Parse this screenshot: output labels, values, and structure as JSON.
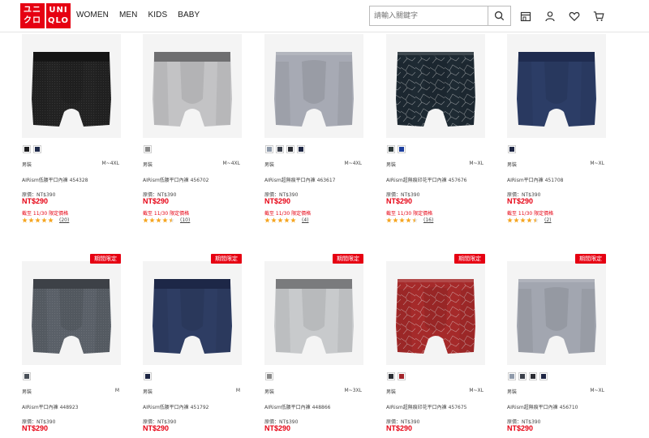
{
  "header": {
    "logo": {
      "left": "ユニ\nクロ",
      "right": "UNI\nQLO"
    },
    "nav": [
      "WOMEN",
      "MEN",
      "KIDS",
      "BABY"
    ],
    "search_placeholder": "請輸入關鍵字"
  },
  "products": [
    {
      "badge": "",
      "swatches": [
        "#1d1d1f",
        "#1f2a4a"
      ],
      "gender": "男裝",
      "size": "M~4XL",
      "name": "AIRism低腰平口內褲 454328",
      "orig": "原價：NT$390",
      "price": "NT$290",
      "promo": "截至 11/30 限定價格",
      "rating": 5,
      "count": "(20)",
      "color": "#222",
      "band": "#151515",
      "pattern": "mesh"
    },
    {
      "badge": "",
      "swatches": [
        "#8a8a8a"
      ],
      "gender": "男裝",
      "size": "M~4XL",
      "name": "AIRism低腰平口內褲 456702",
      "orig": "原價：NT$390",
      "price": "NT$290",
      "promo": "截至 11/30 限定價格",
      "rating": 4.5,
      "count": "(10)",
      "color": "#c3c3c5",
      "band": "#6e6e70",
      "pattern": "plain"
    },
    {
      "badge": "",
      "swatches": [
        "#8f9aaa",
        "#3a3f4a",
        "#2b2d33",
        "#1e2644"
      ],
      "gender": "男裝",
      "size": "M~4XL",
      "name": "AIRism超無痕平口內褲 463617",
      "orig": "原價：NT$390",
      "price": "NT$290",
      "promo": "截至 11/30 限定價格",
      "rating": 5,
      "count": "(4)",
      "color": "#a7aab4",
      "band": "#a7aab4",
      "pattern": "plain"
    },
    {
      "badge": "",
      "swatches": [
        "#2f3a3a",
        "#1d3f9e"
      ],
      "gender": "男裝",
      "size": "M~XL",
      "name": "AIRism超無痕印花平口內褲 457676",
      "orig": "原價：NT$390",
      "price": "NT$290",
      "promo": "截至 11/30 限定價格",
      "rating": 4.5,
      "count": "(16)",
      "color": "#1e2a33",
      "band": "#1e2a33",
      "pattern": "print"
    },
    {
      "badge": "",
      "swatches": [
        "#1e2644"
      ],
      "gender": "男裝",
      "size": "M~XL",
      "name": "AIRism平口內褲 451708",
      "orig": "原價：NT$390",
      "price": "NT$290",
      "promo": "截至 11/30 限定價格",
      "rating": 4.5,
      "count": "(2)",
      "color": "#2c3d66",
      "band": "#1f2c50",
      "pattern": "plain"
    },
    {
      "badge": "期間限定",
      "swatches": [
        "#4a5058"
      ],
      "gender": "男裝",
      "size": "M",
      "name": "AIRism平口內褲 448923",
      "orig": "原價：NT$390",
      "price": "NT$290",
      "promo": "",
      "rating": 0,
      "count": "",
      "color": "#5a6068",
      "band": "#3d4147",
      "pattern": "mesh"
    },
    {
      "badge": "期間限定",
      "swatches": [
        "#1e2644"
      ],
      "gender": "男裝",
      "size": "M",
      "name": "AIRism低腰平口內褲 451792",
      "orig": "原價：NT$390",
      "price": "NT$290",
      "promo": "",
      "rating": 0,
      "count": "",
      "color": "#2e3d63",
      "band": "#1d2747",
      "pattern": "plain"
    },
    {
      "badge": "期間限定",
      "swatches": [
        "#8a8a8a"
      ],
      "gender": "男裝",
      "size": "M~3XL",
      "name": "AIRism低腰平口內褲 448866",
      "orig": "原價：NT$390",
      "price": "NT$290",
      "promo": "",
      "rating": 0,
      "count": "",
      "color": "#c8cacc",
      "band": "#7a7b7d",
      "pattern": "plain"
    },
    {
      "badge": "期間限定",
      "swatches": [
        "#2b2d33",
        "#a2242a"
      ],
      "gender": "男裝",
      "size": "M~XL",
      "name": "AIRism超無痕印花平口內褲 457675",
      "orig": "原價：NT$390",
      "price": "NT$290",
      "promo": "",
      "rating": 0,
      "count": "",
      "color": "#a52a2a",
      "band": "#a52a2a",
      "pattern": "print"
    },
    {
      "badge": "期間限定",
      "swatches": [
        "#8f9aaa",
        "#3a3f4a",
        "#2b2d33",
        "#1e2644"
      ],
      "gender": "男裝",
      "size": "M~XL",
      "name": "AIRism超無痕平口內褲 456710",
      "orig": "原價：NT$390",
      "price": "NT$290",
      "promo": "",
      "rating": 0,
      "count": "",
      "color": "#a2a6b0",
      "band": "#a2a6b0",
      "pattern": "plain"
    }
  ]
}
